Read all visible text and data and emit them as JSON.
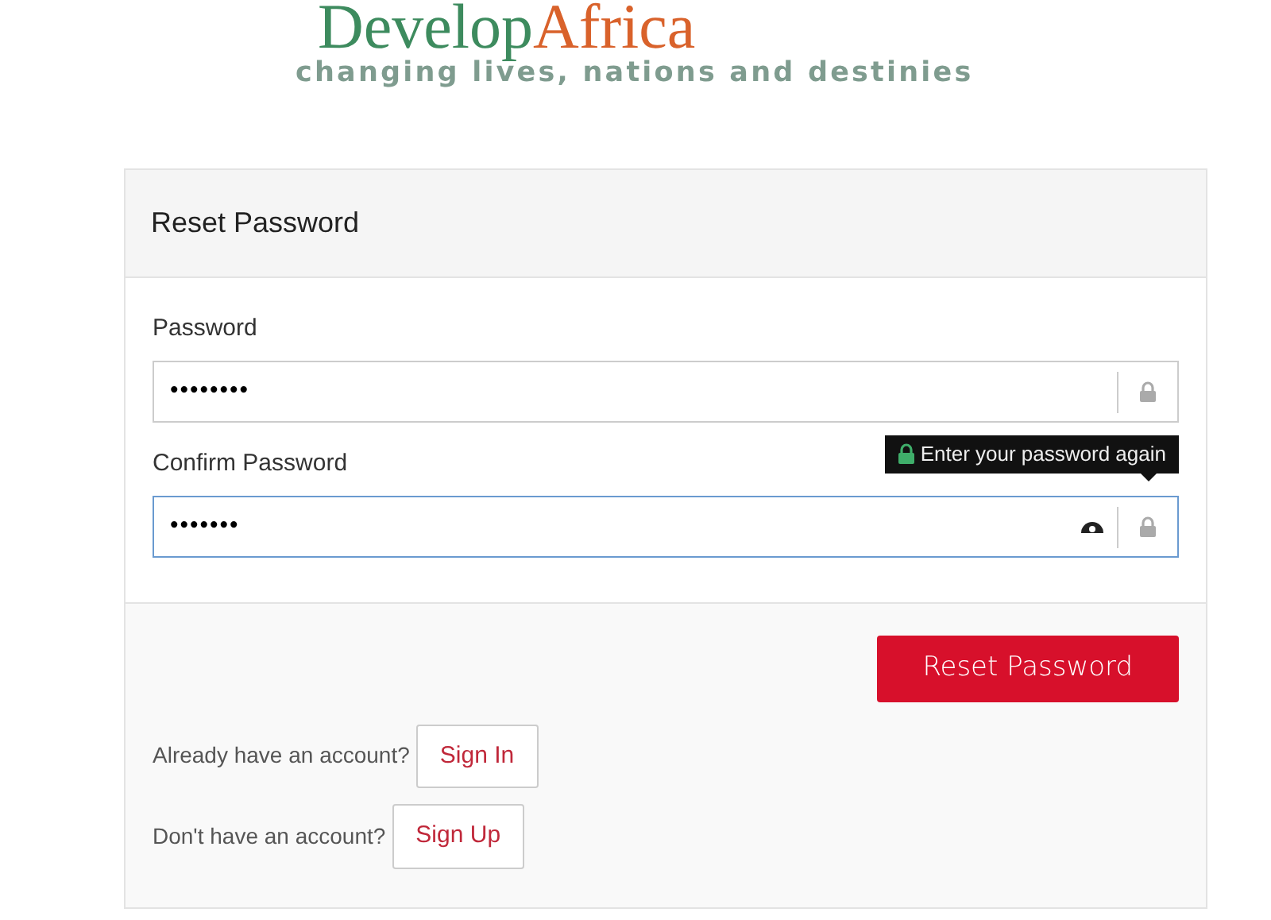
{
  "logo": {
    "name_first": "Develop",
    "name_second": "Africa",
    "tagline": "changing lives, nations and destinies"
  },
  "card": {
    "title": "Reset Password",
    "fields": [
      {
        "label": "Password",
        "value": "••••••••",
        "focused": false,
        "show_eye": false
      },
      {
        "label": "Confirm Password",
        "value": "•••••••",
        "focused": true,
        "show_eye": true,
        "tooltip": "Enter your password again"
      }
    ],
    "submit": "Reset Password",
    "links": [
      {
        "text": "Already have an account?",
        "button": "Sign In"
      },
      {
        "text": "Don't have an account?",
        "button": "Sign Up"
      }
    ]
  }
}
